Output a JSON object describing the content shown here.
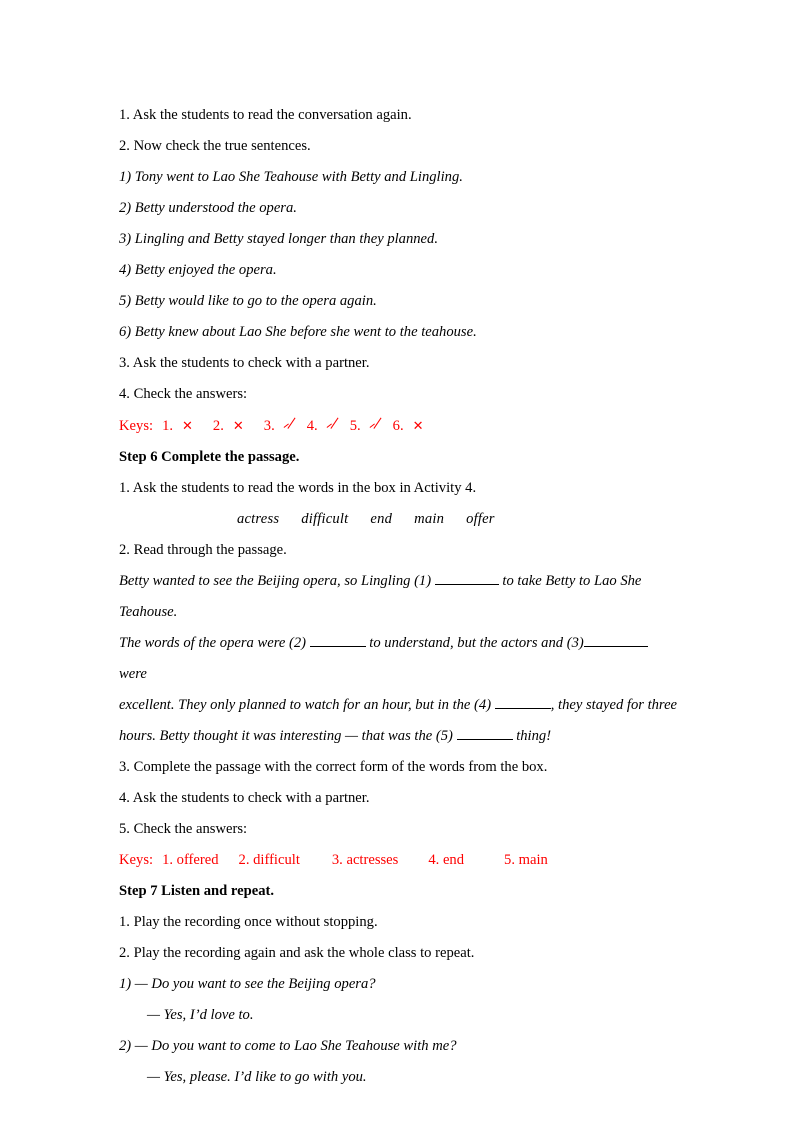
{
  "document": {
    "accent_red": "#fe0000",
    "sections": [
      {
        "id": "step5_check",
        "lines": [
          {
            "text": "1. Ask the students to read the conversation again."
          },
          {
            "text": "2. Now check the true sentences."
          },
          {
            "text": "1) Tony went to Lao She Teahouse with Betty and Lingling."
          },
          {
            "text": "2) Betty understood the opera."
          },
          {
            "text": "3) Lingling and Betty stayed longer than they planned."
          },
          {
            "text": "4) Betty enjoyed the opera."
          },
          {
            "text": "5) Betty would like to go to the opera again."
          },
          {
            "text": "6) Betty knew about Lao She before she went to the teahouse."
          },
          {
            "text": "3. Ask the students to check with a partner."
          },
          {
            "text": "4. Check the answers:"
          }
        ]
      },
      {
        "id": "keys_truefalse",
        "label": "Keys:",
        "items": [
          {
            "number": "1.",
            "mark": "cross"
          },
          {
            "number": "2.",
            "mark": "cross"
          },
          {
            "number": "3.",
            "mark": "check"
          },
          {
            "number": "4.",
            "mark": "check"
          },
          {
            "number": "5.",
            "mark": "check"
          },
          {
            "number": "6.",
            "mark": "cross"
          }
        ],
        "cross_glyph": "✕"
      },
      {
        "id": "step6",
        "heading": "Step 6 Complete the passage.",
        "lines": [
          {
            "text": "1. Ask the students to read the words in the box in Activity 4."
          }
        ]
      },
      {
        "id": "wordbox",
        "words": [
          "actress",
          "difficult",
          "end",
          "main",
          "offer"
        ]
      },
      {
        "id": "step6_read",
        "lines": [
          {
            "text": "2. Read through the passage."
          }
        ]
      },
      {
        "id": "passage",
        "paragraphs": [
          {
            "pre": "Betty wanted to see the Beijing opera, so Lingling (1) ",
            "post": " to take Betty to Lao She Teahouse.",
            "blank": "b-md"
          },
          {
            "pre": "The words of the opera were (2) ",
            "mid": " to understand, but the actors and (3)",
            "post": " were",
            "blank": "b-sm",
            "blank2": "b-md"
          },
          {
            "pre": "excellent. They only planned to watch for an hour, but in the (4) ",
            "post": ", they stayed for three",
            "blank": "b-sm"
          },
          {
            "pre": "hours. Betty thought it was interesting — that was the (5) ",
            "post": " thing!",
            "blank": "b-sm"
          }
        ]
      },
      {
        "id": "step6_after",
        "lines": [
          {
            "text": "3. Complete the passage with the correct form of the words from the box."
          },
          {
            "text": "4. Ask the students to check with a partner."
          },
          {
            "text": "5. Check the answers:"
          }
        ]
      },
      {
        "id": "keys_passage",
        "label": "Keys:",
        "items": [
          {
            "text": "1. offered"
          },
          {
            "text": "2. difficult"
          },
          {
            "text": "3. actresses"
          },
          {
            "text": "4. end"
          },
          {
            "text": "5. main"
          }
        ]
      },
      {
        "id": "step7",
        "heading": "Step 7 Listen and repeat.",
        "lines": [
          {
            "text": "1. Play the recording once without stopping."
          },
          {
            "text": "2. Play the recording again and ask the whole class to repeat."
          }
        ]
      },
      {
        "id": "dialogue",
        "exchanges": [
          {
            "prompt": "1) — Do you want to see the Beijing opera?",
            "reply": "— Yes, I’d love to."
          },
          {
            "prompt": "2) — Do you want to come to Lao She Teahouse with me?",
            "reply": "— Yes, please. I’d like to go with you."
          }
        ]
      }
    ]
  }
}
